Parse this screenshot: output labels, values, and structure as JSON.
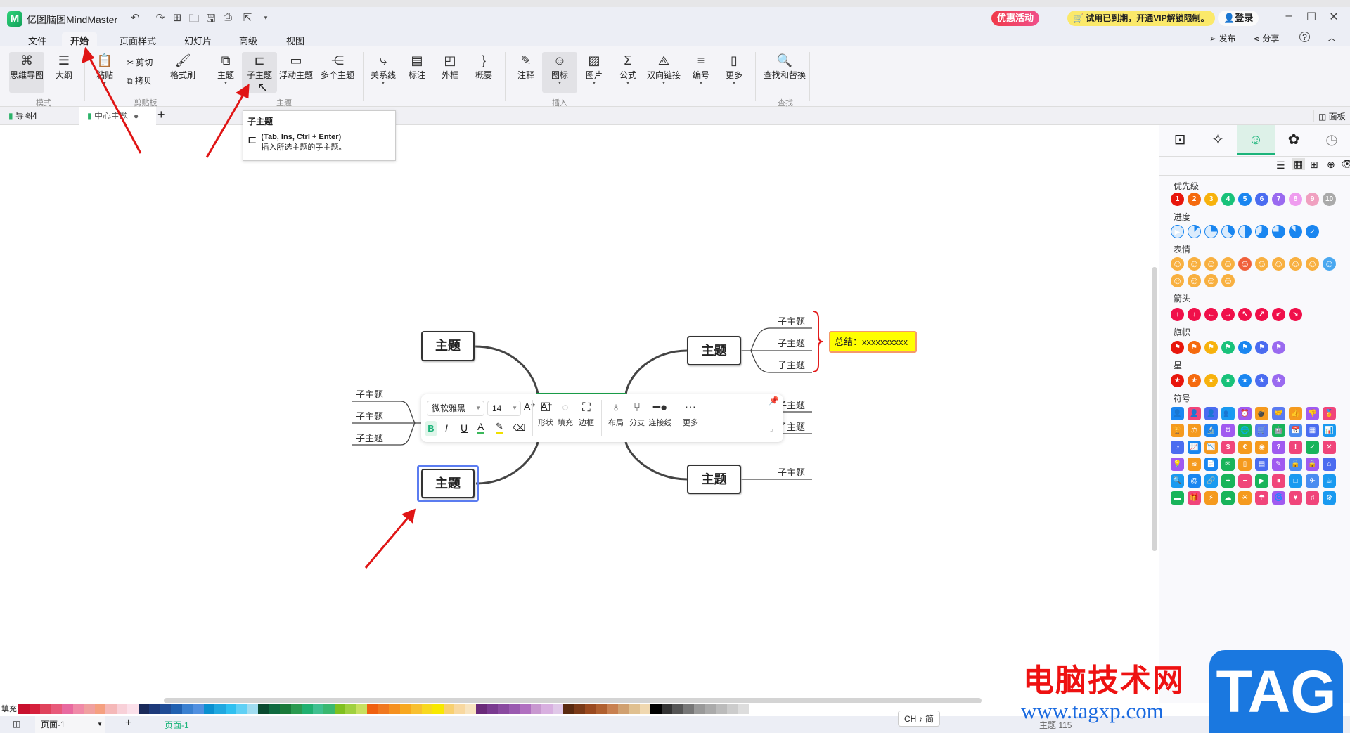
{
  "app": {
    "title": "亿图脑图MindMaster",
    "logo": "M",
    "promo": "优惠活动",
    "vip_notice": "试用已到期，开通VIP解锁限制。",
    "login": "登录",
    "publish": "发布",
    "share": "分享",
    "help": "?"
  },
  "menu": [
    "文件",
    "开始",
    "页面样式",
    "幻灯片",
    "高级",
    "视图"
  ],
  "ribbon": {
    "buttons": [
      {
        "label": "思维导图",
        "icon": "⌘"
      },
      {
        "label": "大纲",
        "icon": "☰"
      },
      {
        "label": "粘贴",
        "icon": "📋"
      },
      {
        "label": "格式刷",
        "icon": "🖌"
      },
      {
        "label": "主题",
        "icon": "⧉"
      },
      {
        "label": "子主题",
        "icon": "⊏"
      },
      {
        "label": "浮动主题",
        "icon": "▭"
      },
      {
        "label": "多个主题",
        "icon": "⋲"
      },
      {
        "label": "关系线",
        "icon": "⤷"
      },
      {
        "label": "标注",
        "icon": "▤"
      },
      {
        "label": "外框",
        "icon": "◰"
      },
      {
        "label": "概要",
        "icon": "}"
      },
      {
        "label": "注释",
        "icon": "✎"
      },
      {
        "label": "图标",
        "icon": "☺"
      },
      {
        "label": "图片",
        "icon": "▨"
      },
      {
        "label": "公式",
        "icon": "Σ"
      },
      {
        "label": "双向链接",
        "icon": "⟁"
      },
      {
        "label": "编号",
        "icon": "≡"
      },
      {
        "label": "更多",
        "icon": "▯"
      },
      {
        "label": "查找和替换",
        "icon": "🔍"
      }
    ],
    "cut": "剪切",
    "copy": "拷贝",
    "groups": [
      "模式",
      "剪贴板",
      "主题",
      "插入",
      "查找"
    ]
  },
  "tabs": {
    "items": [
      "导图4",
      "中心主题"
    ],
    "add": "+",
    "panel": "面板"
  },
  "tooltip": {
    "title": "子主题",
    "shortcut": "(Tab, Ins, Ctrl + Enter)",
    "desc": "插入所选主题的子主题。"
  },
  "map": {
    "topic": "主题",
    "subtopic": "子主题",
    "summary": "总结：xxxxxxxxxx"
  },
  "float_toolbar": {
    "font": "微软雅黑",
    "size": "14",
    "shape": "形状",
    "fill": "填充",
    "border": "边框",
    "layout": "布局",
    "branch": "分支",
    "connector": "连接线",
    "more": "更多"
  },
  "panel": {
    "sections": [
      "优先级",
      "进度",
      "表情",
      "箭头",
      "旗帜",
      "星",
      "符号"
    ],
    "priority": [
      {
        "n": "1",
        "c": "#e8160c"
      },
      {
        "n": "2",
        "c": "#f56a0e"
      },
      {
        "n": "3",
        "c": "#f7b20c"
      },
      {
        "n": "4",
        "c": "#19c27a"
      },
      {
        "n": "5",
        "c": "#1a86f0"
      },
      {
        "n": "6",
        "c": "#4b6cf0"
      },
      {
        "n": "7",
        "c": "#9a6af0"
      },
      {
        "n": "8",
        "c": "#ef9cef"
      },
      {
        "n": "9",
        "c": "#f0a0c0"
      },
      {
        "n": "10",
        "c": "#aaaaaa"
      }
    ],
    "progress": [
      0,
      0.125,
      0.25,
      0.375,
      0.5,
      0.625,
      0.75,
      0.875,
      1
    ],
    "emoji_count": 14,
    "arrows": [
      "↑",
      "↓",
      "←",
      "→",
      "↖",
      "↗",
      "↙",
      "↘"
    ],
    "flag_colors": [
      "#e8160c",
      "#f56a0e",
      "#f7b20c",
      "#19c27a",
      "#1a86f0",
      "#4b6cf0",
      "#9a6af0"
    ],
    "star_colors": [
      "#e8160c",
      "#f56a0e",
      "#f7b20c",
      "#19c27a",
      "#1a86f0",
      "#4b6cf0",
      "#9a6af0"
    ],
    "symbol_colors": [
      "#1a86f0",
      "#f0457a",
      "#4b6cf0",
      "#1a9af0",
      "#a05af0",
      "#f59a1e",
      "#5a7af0",
      "#f59a1e",
      "#a05af0",
      "#f0457a",
      "#f59a1e",
      "#f59a1e",
      "#1a86f0",
      "#a05af0",
      "#19b45a",
      "#5a7af0",
      "#19b45a",
      "#4b8cf0",
      "#4b6cf0",
      "#1a9af0",
      "#4b6cf0",
      "#1a86f0",
      "#f59a1e",
      "#f0457a",
      "#f59a1e",
      "#f59a1e",
      "#a05af0",
      "#f0457a",
      "#19b45a",
      "#f0457a",
      "#a05af0",
      "#f59a1e",
      "#1a86f0",
      "#19b45a",
      "#f59a1e",
      "#4b6cf0",
      "#a05af0",
      "#4b8cf0",
      "#a05af0",
      "#4b6cf0",
      "#1a9af0",
      "#1a86f0",
      "#1a9af0",
      "#19b45a",
      "#f0457a",
      "#19b45a",
      "#f0457a",
      "#1a9af0",
      "#4b8cf0",
      "#1a9af0",
      "#19b45a",
      "#f0457a",
      "#f59a1e",
      "#19b45a",
      "#f59a1e",
      "#f0457a",
      "#a05af0",
      "#f0457a",
      "#f0457a",
      "#1a9af0"
    ]
  },
  "palette": {
    "label": "填充",
    "colors": [
      "#c8102e",
      "#d6203c",
      "#e0435c",
      "#e85a7a",
      "#e86aa0",
      "#f08aa8",
      "#f0a0a0",
      "#f5a080",
      "#f5b8b8",
      "#f8d0d8",
      "#fbe0ea",
      "#1a2a5a",
      "#1e3a7a",
      "#1f4c96",
      "#2060b0",
      "#3a80d0",
      "#5090e0",
      "#0a90d0",
      "#20a8e0",
      "#30c0f0",
      "#60d0f5",
      "#a0dcf0",
      "#0a4a30",
      "#0f6a40",
      "#1a7a3a",
      "#2a9a50",
      "#20b070",
      "#40c090",
      "#3ab870",
      "#80c020",
      "#a0d040",
      "#c8e060",
      "#f06010",
      "#f07820",
      "#f59020",
      "#f8a820",
      "#f8c030",
      "#f8d820",
      "#f8e800",
      "#f8d070",
      "#f8d8a0",
      "#f8e4c0",
      "#6a2a7a",
      "#7a3a90",
      "#8a4aa0",
      "#9a5ab0",
      "#b070c0",
      "#c898d0",
      "#d8b0e0",
      "#e0c8e8",
      "#5a2a10",
      "#7a3a18",
      "#9a4a20",
      "#b06030",
      "#c88050",
      "#d0a070",
      "#e0c090",
      "#f0d8b0",
      "#000000",
      "#333333",
      "#555555",
      "#777777",
      "#999999",
      "#aaaaaa",
      "#bbbbbb",
      "#cccccc",
      "#dddddd"
    ]
  },
  "status": {
    "page_select": "页面-1",
    "add": "+",
    "page_tab": "页面-1",
    "ime": "CH ♪ 简",
    "topic_count": "主题 115"
  },
  "watermark": {
    "cn": "电脑技术网",
    "url": "www.tagxp.com",
    "logo": "TAG"
  }
}
